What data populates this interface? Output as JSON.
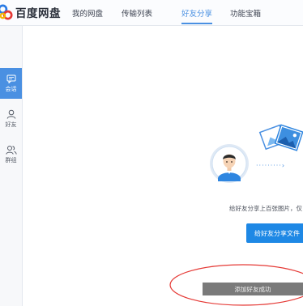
{
  "app": {
    "title": "百度网盘"
  },
  "nav": {
    "items": [
      {
        "label": "我的网盘",
        "active": false
      },
      {
        "label": "传输列表",
        "active": false
      },
      {
        "label": "好友分享",
        "active": true
      },
      {
        "label": "功能宝箱",
        "active": false
      }
    ]
  },
  "sidebar": {
    "items": [
      {
        "label": "会话",
        "icon": "chat-icon",
        "active": true
      },
      {
        "label": "好友",
        "icon": "friend-icon",
        "active": false
      },
      {
        "label": "群组",
        "icon": "group-icon",
        "active": false
      }
    ]
  },
  "main": {
    "promo_text": "给好友分享上百张图片，仅",
    "share_button_label": "给好友分享文件",
    "toast_text": "添加好友成功"
  },
  "colors": {
    "accent": "#4a90e2",
    "button": "#1e88e5",
    "annotation": "#e53935"
  }
}
